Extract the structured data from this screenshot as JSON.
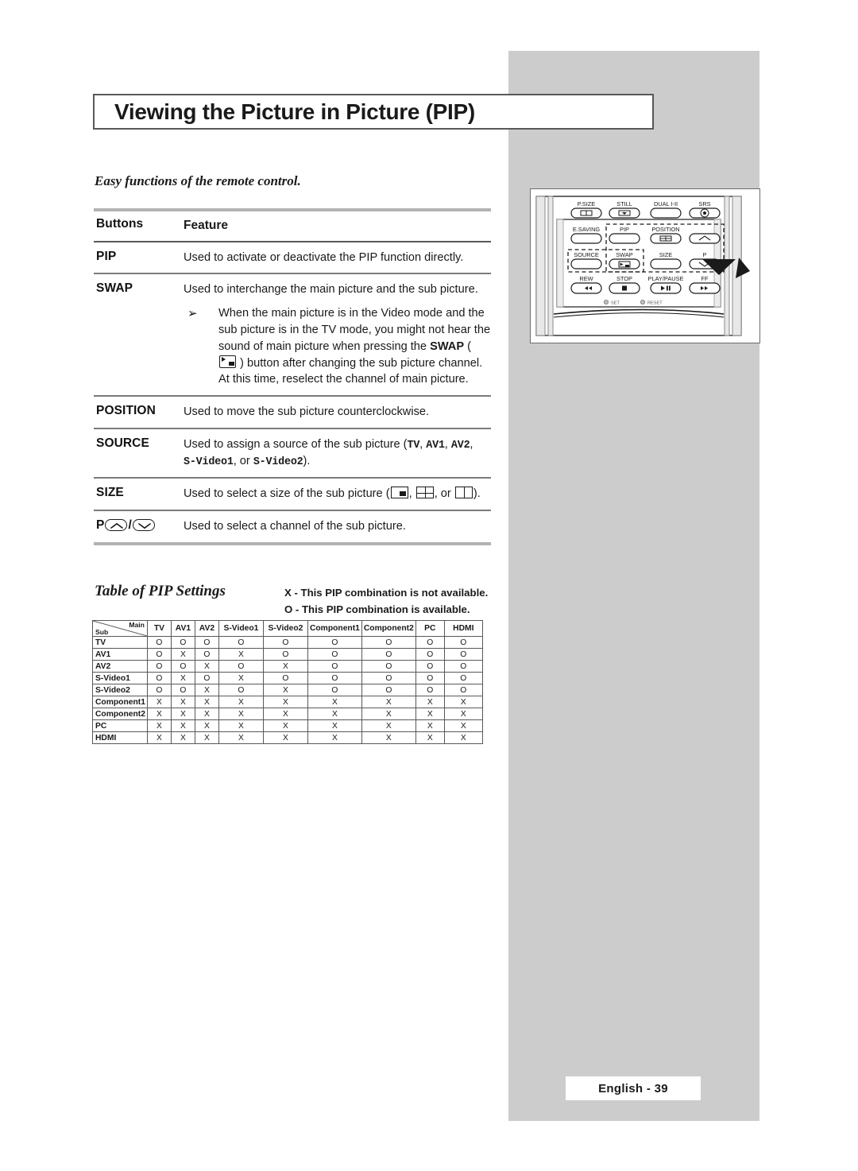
{
  "page": {
    "title": "Viewing the Picture in Picture (PIP)",
    "intro": "Easy functions of the remote control.",
    "footer": "English - 39",
    "accent_gray": "#cccccc",
    "rule_gray": "#b3b3b3",
    "text_color": "#1a1a1a"
  },
  "feature_table": {
    "header": {
      "buttons": "Buttons",
      "feature": "Feature"
    },
    "rows": [
      {
        "button": "PIP",
        "feature": "Used to activate or deactivate the PIP function directly."
      },
      {
        "button": "SWAP",
        "feature": "Used to interchange the main picture and the sub picture.",
        "note": {
          "bullet": "➢",
          "part1": "When the main picture is in the Video mode and the sub picture is in the TV mode, you might not hear the sound of main picture when pressing the ",
          "bold1": "SWAP",
          "paren_open": " ( ",
          "icon": "swap-picture-icon",
          "paren_close": " ) ",
          "part2": "button after changing the sub picture channel. At this time, reselect the channel of main picture."
        }
      },
      {
        "button": "POSITION",
        "feature": "Used to move the sub picture counterclockwise."
      },
      {
        "button": "SOURCE",
        "feature_pre": "Used to assign a source of the sub picture (",
        "sources": [
          "TV",
          "AV1",
          "AV2",
          "S-Video1",
          "S-Video2"
        ],
        "feature_or": ", or ",
        "feature_post": ")."
      },
      {
        "button": "SIZE",
        "feature_pre": "Used to select a size of the sub picture (",
        "size_icons": [
          "size-small-icon",
          "size-double-icon",
          "size-split-icon"
        ],
        "feature_or": ", or ",
        "feature_post": ")."
      },
      {
        "button_pre": "P",
        "button_icons": [
          "channel-up-icon",
          "channel-down-icon"
        ],
        "button_sep": "/",
        "feature": "Used to select a channel of the sub picture."
      }
    ]
  },
  "pip_settings": {
    "title": "Table of PIP Settings",
    "legend": [
      "X - This PIP combination is not available.",
      "O - This PIP combination is available."
    ],
    "corner": {
      "sub": "Sub",
      "main": "Main"
    },
    "columns": [
      "TV",
      "AV1",
      "AV2",
      "S-Video1",
      "S-Video2",
      "Component1",
      "Component2",
      "PC",
      "HDMI"
    ],
    "rows": [
      {
        "label": "TV",
        "cells": [
          "O",
          "O",
          "O",
          "O",
          "O",
          "O",
          "O",
          "O",
          "O"
        ]
      },
      {
        "label": "AV1",
        "cells": [
          "O",
          "X",
          "O",
          "X",
          "O",
          "O",
          "O",
          "O",
          "O"
        ]
      },
      {
        "label": "AV2",
        "cells": [
          "O",
          "O",
          "X",
          "O",
          "X",
          "O",
          "O",
          "O",
          "O"
        ]
      },
      {
        "label": "S-Video1",
        "cells": [
          "O",
          "X",
          "O",
          "X",
          "O",
          "O",
          "O",
          "O",
          "O"
        ]
      },
      {
        "label": "S-Video2",
        "cells": [
          "O",
          "O",
          "X",
          "O",
          "X",
          "O",
          "O",
          "O",
          "O"
        ]
      },
      {
        "label": "Component1",
        "cells": [
          "X",
          "X",
          "X",
          "X",
          "X",
          "X",
          "X",
          "X",
          "X"
        ]
      },
      {
        "label": "Component2",
        "cells": [
          "X",
          "X",
          "X",
          "X",
          "X",
          "X",
          "X",
          "X",
          "X"
        ]
      },
      {
        "label": "PC",
        "cells": [
          "X",
          "X",
          "X",
          "X",
          "X",
          "X",
          "X",
          "X",
          "X"
        ]
      },
      {
        "label": "HDMI",
        "cells": [
          "X",
          "X",
          "X",
          "X",
          "X",
          "X",
          "X",
          "X",
          "X"
        ]
      }
    ]
  },
  "remote": {
    "row1": [
      "P.SIZE",
      "STILL",
      "DUAL I-II",
      "SRS"
    ],
    "row2": [
      "E.SAVING",
      "PIP",
      "POSITION",
      ""
    ],
    "row3": [
      "SOURCE",
      "SWAP",
      "SIZE",
      "P"
    ],
    "row4": [
      "REW",
      "STOP",
      "PLAY/PAUSE",
      "FF"
    ],
    "row5": [
      "SET",
      "RESET"
    ]
  }
}
